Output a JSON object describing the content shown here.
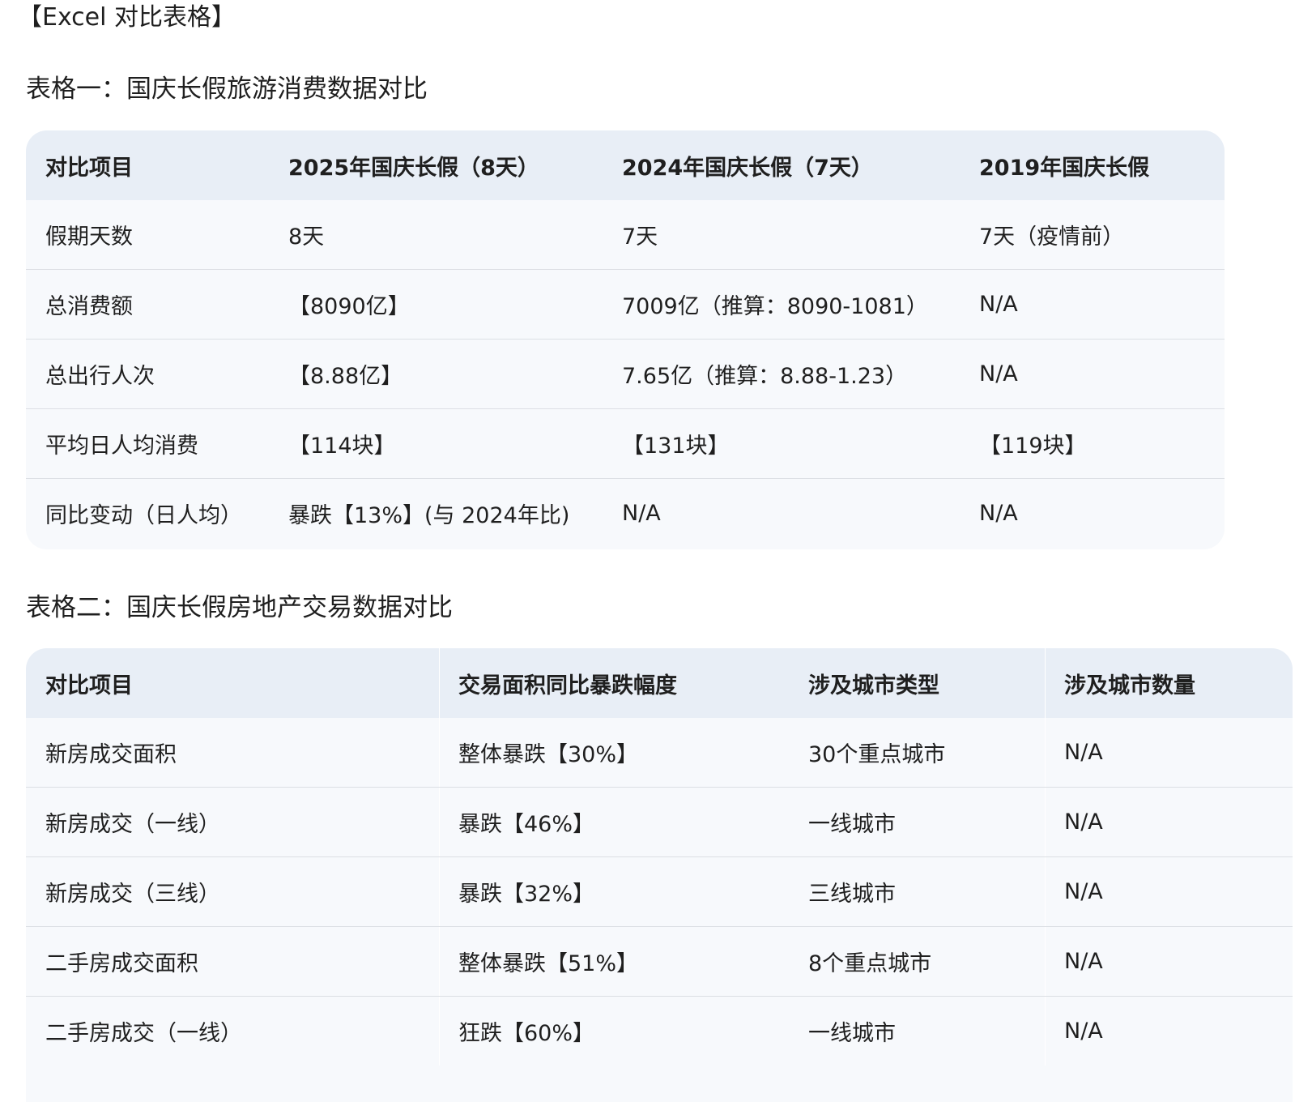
{
  "doc_title": "【Excel 对比表格】",
  "table1": {
    "title": "表格一：国庆长假旅游消费数据对比",
    "headers": [
      "对比项目",
      "2025年国庆长假（8天）",
      "2024年国庆长假（7天）",
      "2019年国庆长假"
    ],
    "rows": [
      [
        "假期天数",
        "8天",
        "7天",
        "7天（疫情前）"
      ],
      [
        "总消费额",
        "【8090亿】",
        "7009亿（推算：8090-1081）",
        "N/A"
      ],
      [
        "总出行人次",
        "【8.88亿】",
        "7.65亿（推算：8.88-1.23）",
        "N/A"
      ],
      [
        "平均日人均消费",
        "【114块】",
        "【131块】",
        "【119块】"
      ],
      [
        "同比变动（日人均）",
        "暴跌【13%】(与 2024年比)",
        "N/A",
        "N/A"
      ]
    ]
  },
  "table2": {
    "title": "表格二：国庆长假房地产交易数据对比",
    "headers": [
      "对比项目",
      "交易面积同比暴跌幅度",
      "涉及城市类型",
      "涉及城市数量"
    ],
    "rows": [
      [
        "新房成交面积",
        "整体暴跌【30%】",
        "30个重点城市",
        "N/A"
      ],
      [
        "新房成交（一线）",
        "暴跌【46%】",
        "一线城市",
        "N/A"
      ],
      [
        "新房成交（三线）",
        "暴跌【32%】",
        "三线城市",
        "N/A"
      ],
      [
        "二手房成交面积",
        "整体暴跌【51%】",
        "8个重点城市",
        "N/A"
      ],
      [
        "二手房成交（一线）",
        "狂跌【60%】",
        "一线城市",
        "N/A"
      ]
    ]
  }
}
